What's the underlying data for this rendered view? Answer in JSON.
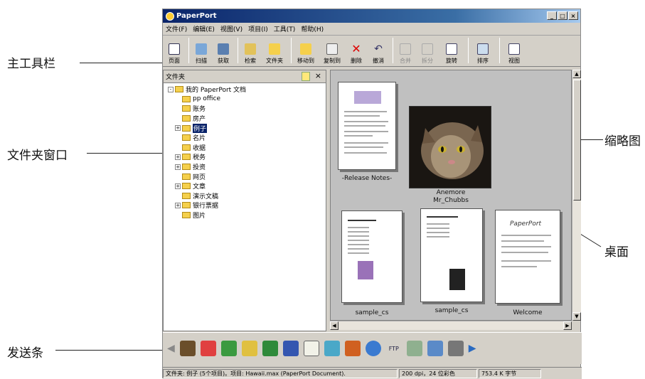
{
  "callouts": {
    "main_toolbar": "主工具栏",
    "folder_window": "文件夹窗口",
    "send_bar": "发送条",
    "thumbnail": "缩略图",
    "desktop": "桌面"
  },
  "window": {
    "title": "PaperPort",
    "controls": [
      "_",
      "□",
      "×"
    ]
  },
  "menu": [
    "文件(F)",
    "编辑(E)",
    "视图(V)",
    "项目(I)",
    "工具(T)",
    "帮助(H)"
  ],
  "toolbar": {
    "buttons": [
      {
        "label": "页面",
        "icon": "page-icon"
      },
      {
        "label": "扫描",
        "icon": "scan-icon"
      },
      {
        "label": "获取",
        "icon": "acquire-icon"
      },
      {
        "label": "检索",
        "icon": "search-icon"
      },
      {
        "label": "文件夹",
        "icon": "folder-icon"
      },
      {
        "label": "移动到",
        "icon": "move-to-icon"
      },
      {
        "label": "复制到",
        "icon": "copy-to-icon"
      },
      {
        "label": "删除",
        "icon": "delete-icon"
      },
      {
        "label": "撤消",
        "icon": "undo-icon"
      },
      {
        "label": "合并",
        "icon": "merge-icon"
      },
      {
        "label": "拆分",
        "icon": "split-icon"
      },
      {
        "label": "旋转",
        "icon": "rotate-icon"
      },
      {
        "label": "排序",
        "icon": "sort-icon"
      },
      {
        "label": "视图",
        "icon": "view-icon"
      }
    ]
  },
  "folder_panel": {
    "title": "文件夹",
    "close": "×",
    "root": "我的 PaperPort 文档",
    "items": [
      "pp office",
      "账务",
      "房产",
      "例子",
      "名片",
      "收据",
      "税务",
      "投资",
      "网页",
      "文章",
      "演示文稿",
      "银行票据",
      "图片"
    ],
    "selected": "例子"
  },
  "desktop": {
    "items": [
      {
        "label": "-Release Notes-"
      },
      {
        "label": "Anemore\nMr_Chubbs"
      },
      {
        "label": "sample_cs"
      },
      {
        "label": "sample_cs"
      },
      {
        "label": "Welcome"
      }
    ],
    "doc_logo": "PaperPort"
  },
  "send_bar": {
    "icons": [
      "left-arrow-icon",
      "network-icon",
      "acrobat-icon",
      "image-editor-icon",
      "paint-icon",
      "excel-icon",
      "word-icon",
      "notepad-icon",
      "wordpad-icon",
      "powerpoint-icon",
      "ie-icon",
      "ftp-icon",
      "recycle-icon",
      "fax-icon",
      "printer-icon",
      "right-arrow-icon"
    ],
    "ftp_label": "FTP"
  },
  "statusbar": {
    "text": "文件夹: 例子 (5个项目)。项目: Hawaii.max (PaperPort Document).",
    "dpi": "200 dpi，24 位彩色",
    "size": "753.4 K 字节"
  }
}
